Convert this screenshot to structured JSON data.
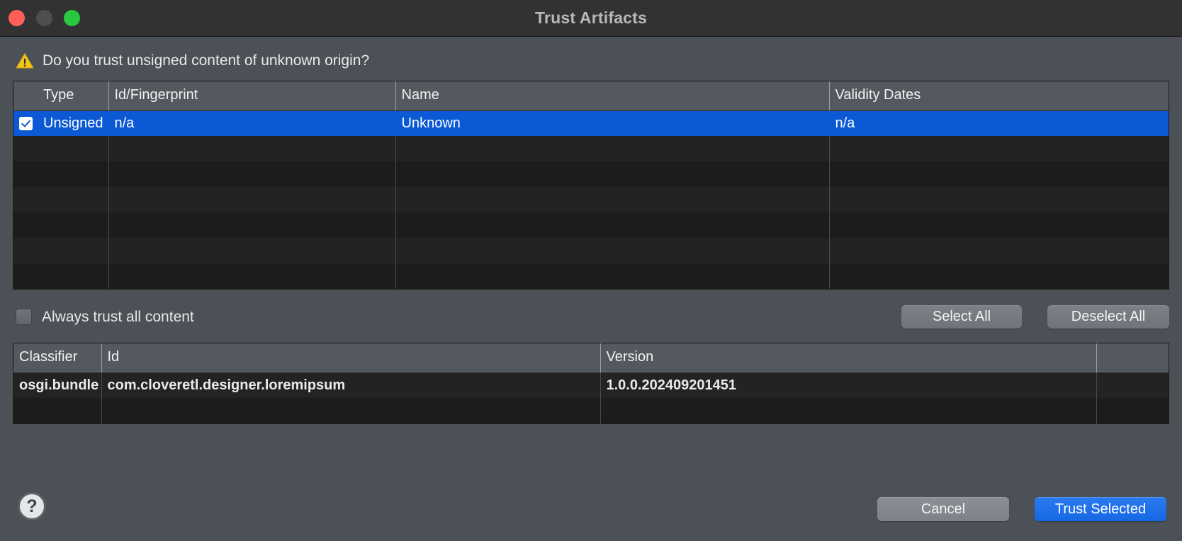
{
  "window": {
    "title": "Trust Artifacts",
    "traffic_lights": {
      "close_color": "#ff5f57",
      "minimize_color": "#4e4e4e",
      "zoom_color": "#28c840"
    }
  },
  "prompt": {
    "icon": "warning-triangle-icon",
    "text": "Do you trust unsigned content of unknown origin?"
  },
  "artifacts_table": {
    "columns": [
      "Type",
      "Id/Fingerprint",
      "Name",
      "Validity Dates"
    ],
    "rows": [
      {
        "checked": true,
        "selected": true,
        "type": "Unsigned",
        "id_fingerprint": "n/a",
        "name": "Unknown",
        "validity_dates": "n/a"
      }
    ],
    "empty_row_count": 5
  },
  "controls": {
    "always_trust_label": "Always trust all content",
    "always_trust_checked": false,
    "select_all_label": "Select All",
    "deselect_all_label": "Deselect All"
  },
  "details_table": {
    "columns": [
      "Classifier",
      "Id",
      "Version"
    ],
    "rows": [
      {
        "classifier": "osgi.bundle",
        "id": "com.cloveretl.designer.loremipsum",
        "version": "1.0.0.202409201451"
      }
    ],
    "empty_row_count": 1
  },
  "footer": {
    "help_label": "?",
    "cancel_label": "Cancel",
    "trust_selected_label": "Trust Selected"
  },
  "colors": {
    "accent_blue": "#1667e3",
    "selection_blue": "#0b59d4",
    "warning_yellow": "#f5c518",
    "dialog_bg": "#4b5156",
    "titlebar_bg": "#323232"
  }
}
